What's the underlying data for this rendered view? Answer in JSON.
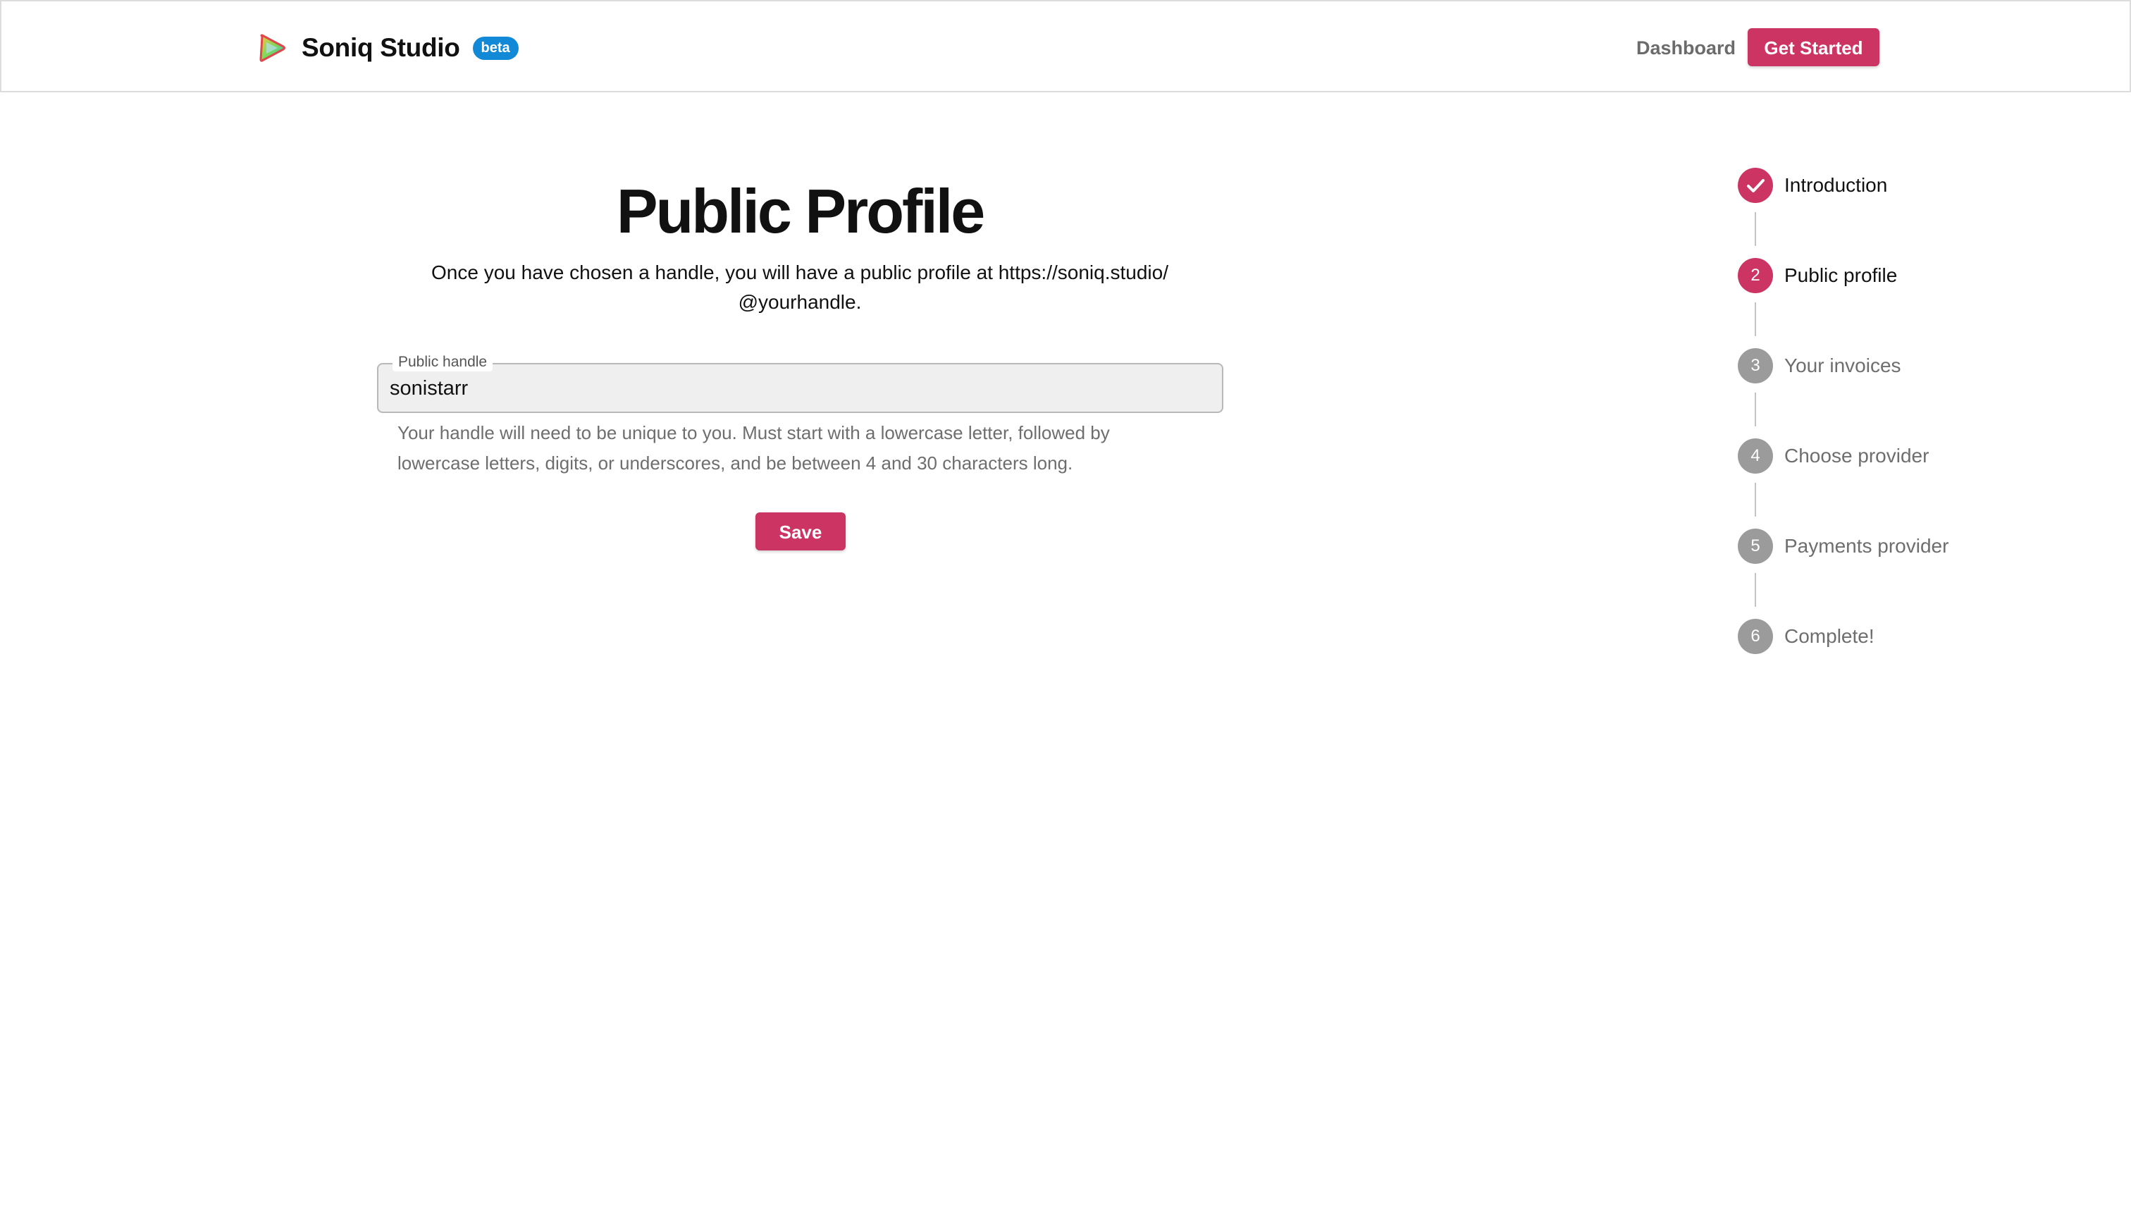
{
  "header": {
    "brand_name": "Soniq Studio",
    "beta_badge": "beta",
    "nav_dashboard": "Dashboard",
    "get_started": "Get Started"
  },
  "main": {
    "title": "Public Profile",
    "subtitle_line1": "Once you have chosen a handle, you will have a public profile at https://soniq.studio/",
    "subtitle_line2": "@yourhandle.",
    "field_label": "Public handle",
    "field_value": "sonistarr",
    "helper_line1": "Your handle will need to be unique to you. Must start with a lowercase letter, followed by",
    "helper_line2": "lowercase letters, digits, or underscores, and be between 4 and 30 characters long.",
    "save_label": "Save"
  },
  "stepper": {
    "steps": [
      {
        "number": "",
        "label": "Introduction",
        "status": "done"
      },
      {
        "number": "2",
        "label": "Public profile",
        "status": "active"
      },
      {
        "number": "3",
        "label": "Your invoices",
        "status": "pending"
      },
      {
        "number": "4",
        "label": "Choose provider",
        "status": "pending"
      },
      {
        "number": "5",
        "label": "Payments provider",
        "status": "pending"
      },
      {
        "number": "6",
        "label": "Complete!",
        "status": "pending"
      }
    ]
  },
  "colors": {
    "accent": "#cc3464",
    "beta_badge": "#1289d6",
    "pending_step": "#9b9b9b"
  }
}
